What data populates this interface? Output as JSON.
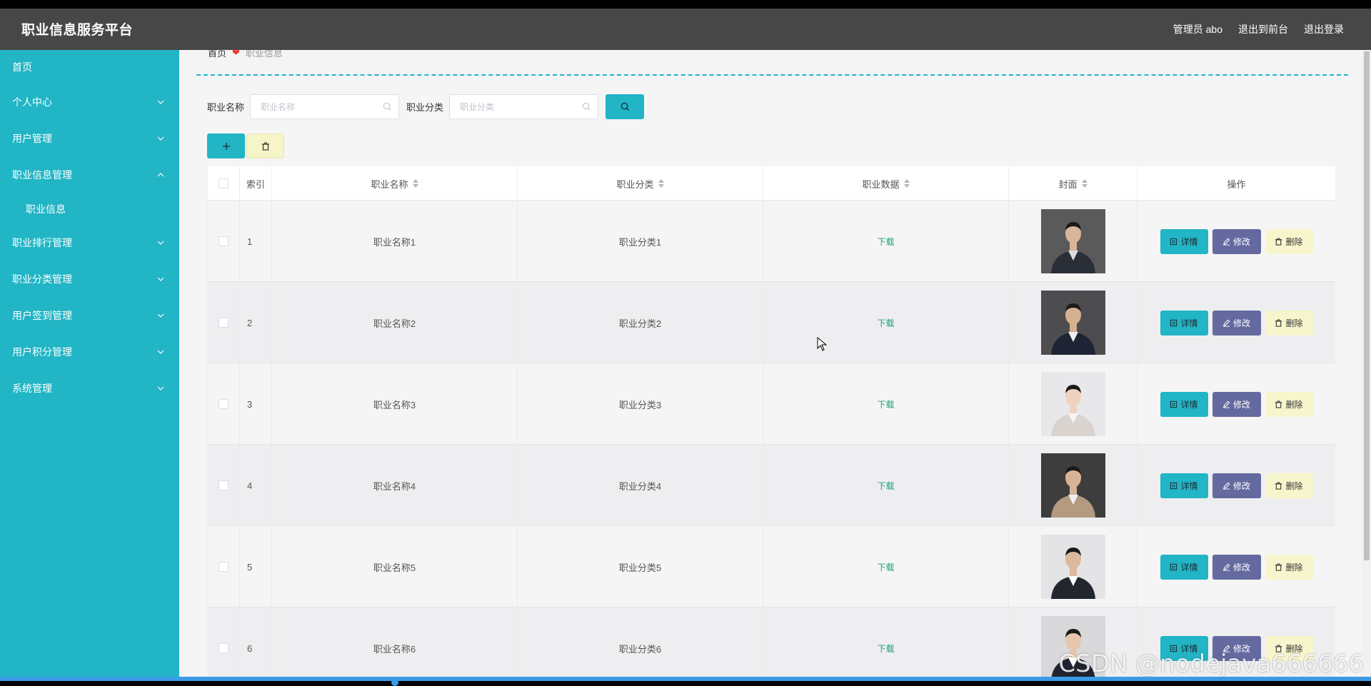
{
  "header": {
    "title": "职业信息服务平台",
    "admin": "管理员 abo",
    "back_to_front": "退出到前台",
    "logout": "退出登录"
  },
  "sidebar": {
    "items": [
      {
        "label": "首页",
        "chevron": ""
      },
      {
        "label": "个人中心",
        "chevron": "down"
      },
      {
        "label": "用户管理",
        "chevron": "down"
      },
      {
        "label": "职业信息管理",
        "chevron": "up"
      },
      {
        "label": "职业信息",
        "chevron": "",
        "sub": true
      },
      {
        "label": "职业排行管理",
        "chevron": "down"
      },
      {
        "label": "职业分类管理",
        "chevron": "down"
      },
      {
        "label": "用户签到管理",
        "chevron": "down"
      },
      {
        "label": "用户积分管理",
        "chevron": "down"
      },
      {
        "label": "系统管理",
        "chevron": "down"
      }
    ]
  },
  "breadcrumb": {
    "home": "首页",
    "current": "职业信息"
  },
  "search": {
    "name_label": "职业名称",
    "name_placeholder": "职业名称",
    "category_label": "职业分类",
    "category_placeholder": "职业分类"
  },
  "table": {
    "headers": {
      "index": "索引",
      "name": "职业名称",
      "category": "职业分类",
      "data": "职业数据",
      "cover": "封面",
      "ops": "操作"
    },
    "rows": [
      {
        "index": "1",
        "name": "职业名称1",
        "category": "职业分类1",
        "data": "下载"
      },
      {
        "index": "2",
        "name": "职业名称2",
        "category": "职业分类2",
        "data": "下载"
      },
      {
        "index": "3",
        "name": "职业名称3",
        "category": "职业分类3",
        "data": "下载"
      },
      {
        "index": "4",
        "name": "职业名称4",
        "category": "职业分类4",
        "data": "下载"
      },
      {
        "index": "5",
        "name": "职业名称5",
        "category": "职业分类5",
        "data": "下载"
      },
      {
        "index": "6",
        "name": "职业名称6",
        "category": "职业分类6",
        "data": "下载"
      }
    ],
    "op_labels": {
      "detail": "详情",
      "edit": "修改",
      "delete": "删除"
    }
  },
  "watermark": "CSDN @nodejava666666",
  "colors": {
    "accent": "#21b5c5",
    "header_bg": "#474747",
    "edit_btn": "#646aa0",
    "delete_btn": "#f7f5cc",
    "download_link": "#1aa37a"
  }
}
